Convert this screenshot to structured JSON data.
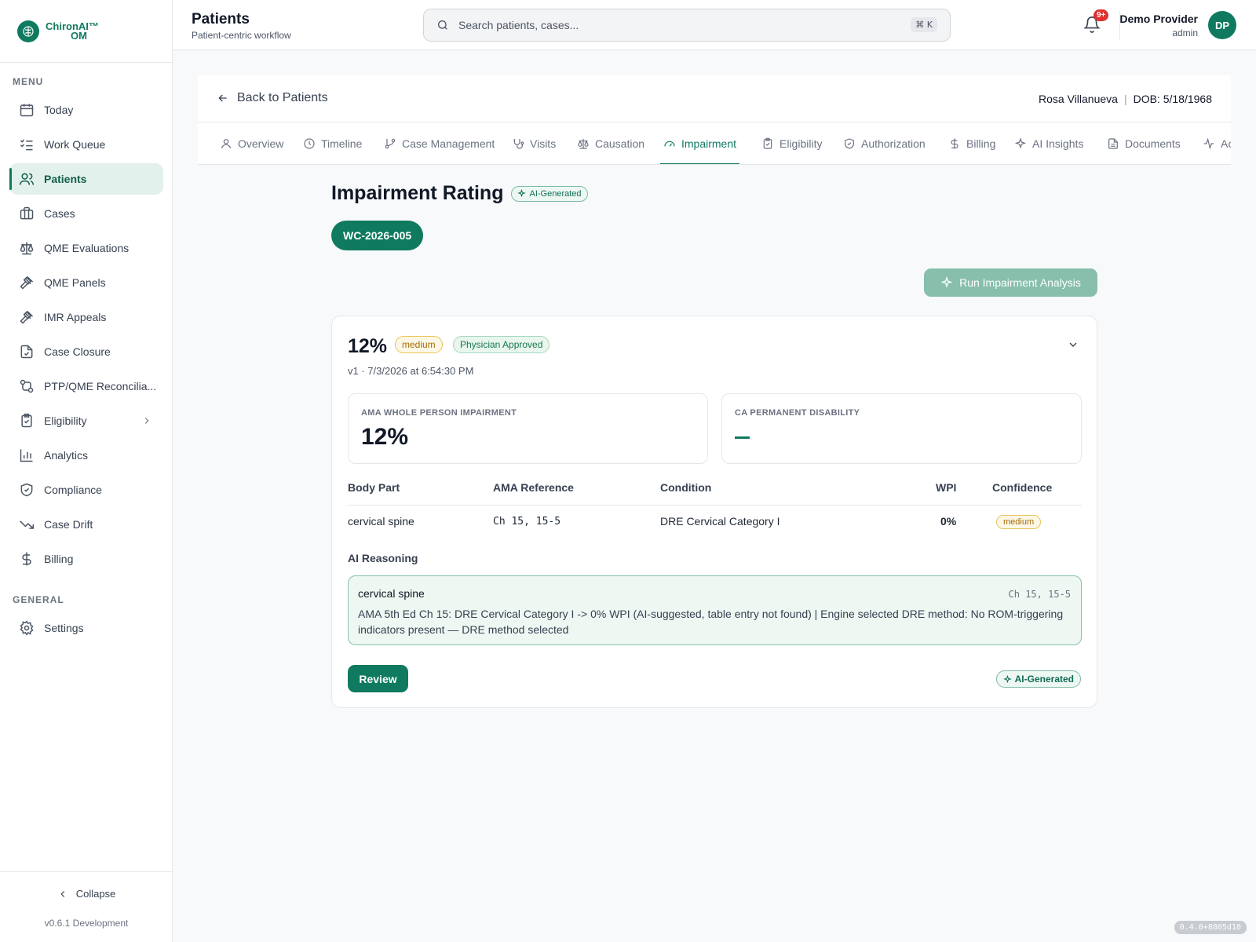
{
  "brand": {
    "name_line1": "ChironAI™",
    "name_line2": "OM",
    "accent": "#0f7a5f"
  },
  "sidebar": {
    "menu_label": "MENU",
    "items": [
      {
        "label": "Today",
        "icon": "calendar-icon"
      },
      {
        "label": "Work Queue",
        "icon": "list-checks-icon"
      },
      {
        "label": "Patients",
        "icon": "users-icon",
        "active": true
      },
      {
        "label": "Cases",
        "icon": "briefcase-icon"
      },
      {
        "label": "QME Evaluations",
        "icon": "scale-icon"
      },
      {
        "label": "QME Panels",
        "icon": "gavel-icon"
      },
      {
        "label": "IMR Appeals",
        "icon": "gavel-icon"
      },
      {
        "label": "Case Closure",
        "icon": "file-check-icon"
      },
      {
        "label": "PTP/QME Reconcilia...",
        "icon": "git-compare-icon"
      },
      {
        "label": "Eligibility",
        "icon": "clipboard-check-icon"
      },
      {
        "label": "Analytics",
        "icon": "bar-chart-icon"
      },
      {
        "label": "Compliance",
        "icon": "shield-check-icon"
      },
      {
        "label": "Case Drift",
        "icon": "trending-down-icon"
      },
      {
        "label": "Billing",
        "icon": "dollar-icon"
      }
    ],
    "general_label": "GENERAL",
    "general_items": [
      {
        "label": "Settings",
        "icon": "gear-icon"
      }
    ],
    "collapse_label": "Collapse",
    "version": "v0.6.1 Development"
  },
  "header": {
    "title": "Patients",
    "subtitle": "Patient-centric workflow",
    "search_placeholder": "Search patients, cases...",
    "shortcut": "⌘ K",
    "notif_count": "9+",
    "user_name": "Demo Provider",
    "user_role": "admin",
    "avatar_initials": "DP"
  },
  "patient": {
    "back_label": "Back to Patients",
    "name": "Rosa Villanueva",
    "dob": "DOB: 5/18/1968"
  },
  "tabs": [
    {
      "label": "Overview",
      "icon": "user-icon"
    },
    {
      "label": "Timeline",
      "icon": "clock-icon"
    },
    {
      "label": "Case Management",
      "icon": "git-branch-icon"
    },
    {
      "label": "Visits",
      "icon": "stethoscope-icon"
    },
    {
      "label": "Causation",
      "icon": "scale-icon"
    },
    {
      "label": "Impairment",
      "icon": "gauge-icon",
      "active": true
    },
    {
      "label": "Eligibility",
      "icon": "clipboard-check-icon"
    },
    {
      "label": "Authorization",
      "icon": "shield-check-icon"
    },
    {
      "label": "Billing",
      "icon": "dollar-icon"
    },
    {
      "label": "AI Insights",
      "icon": "sparkles-icon"
    },
    {
      "label": "Documents",
      "icon": "file-text-icon"
    },
    {
      "label": "Ac",
      "icon": "activity-icon"
    }
  ],
  "impairment": {
    "title": "Impairment Rating",
    "ai_badge": "AI-Generated",
    "case_id": "WC-2026-005",
    "run_button": "Run Impairment Analysis",
    "rating": {
      "percent": "12%",
      "severity": "medium",
      "status": "Physician Approved",
      "meta": "v1 · 7/3/2026 at 6:54:30 PM",
      "ama_label": "AMA WHOLE PERSON IMPAIRMENT",
      "ama_value": "12%",
      "ca_label": "CA PERMANENT DISABILITY",
      "ca_value": "—"
    },
    "table": {
      "headers": [
        "Body Part",
        "AMA Reference",
        "Condition",
        "WPI",
        "Confidence"
      ],
      "rows": [
        {
          "body_part": "cervical spine",
          "reference": "Ch 15, 15-5",
          "condition": "DRE Cervical Category I",
          "wpi": "0%",
          "confidence": "medium"
        }
      ]
    },
    "reasoning_title": "AI Reasoning",
    "reasoning": {
      "part": "cervical spine",
      "reference": "Ch 15, 15-5",
      "text": "AMA 5th Ed Ch 15: DRE Cervical Category I -> 0% WPI (AI-suggested, table entry not found) | Engine selected DRE method: No ROM-triggering indicators present — DRE method selected"
    },
    "review_button": "Review",
    "footer_badge": "AI-Generated"
  },
  "build": "0.4.0+8805d10"
}
